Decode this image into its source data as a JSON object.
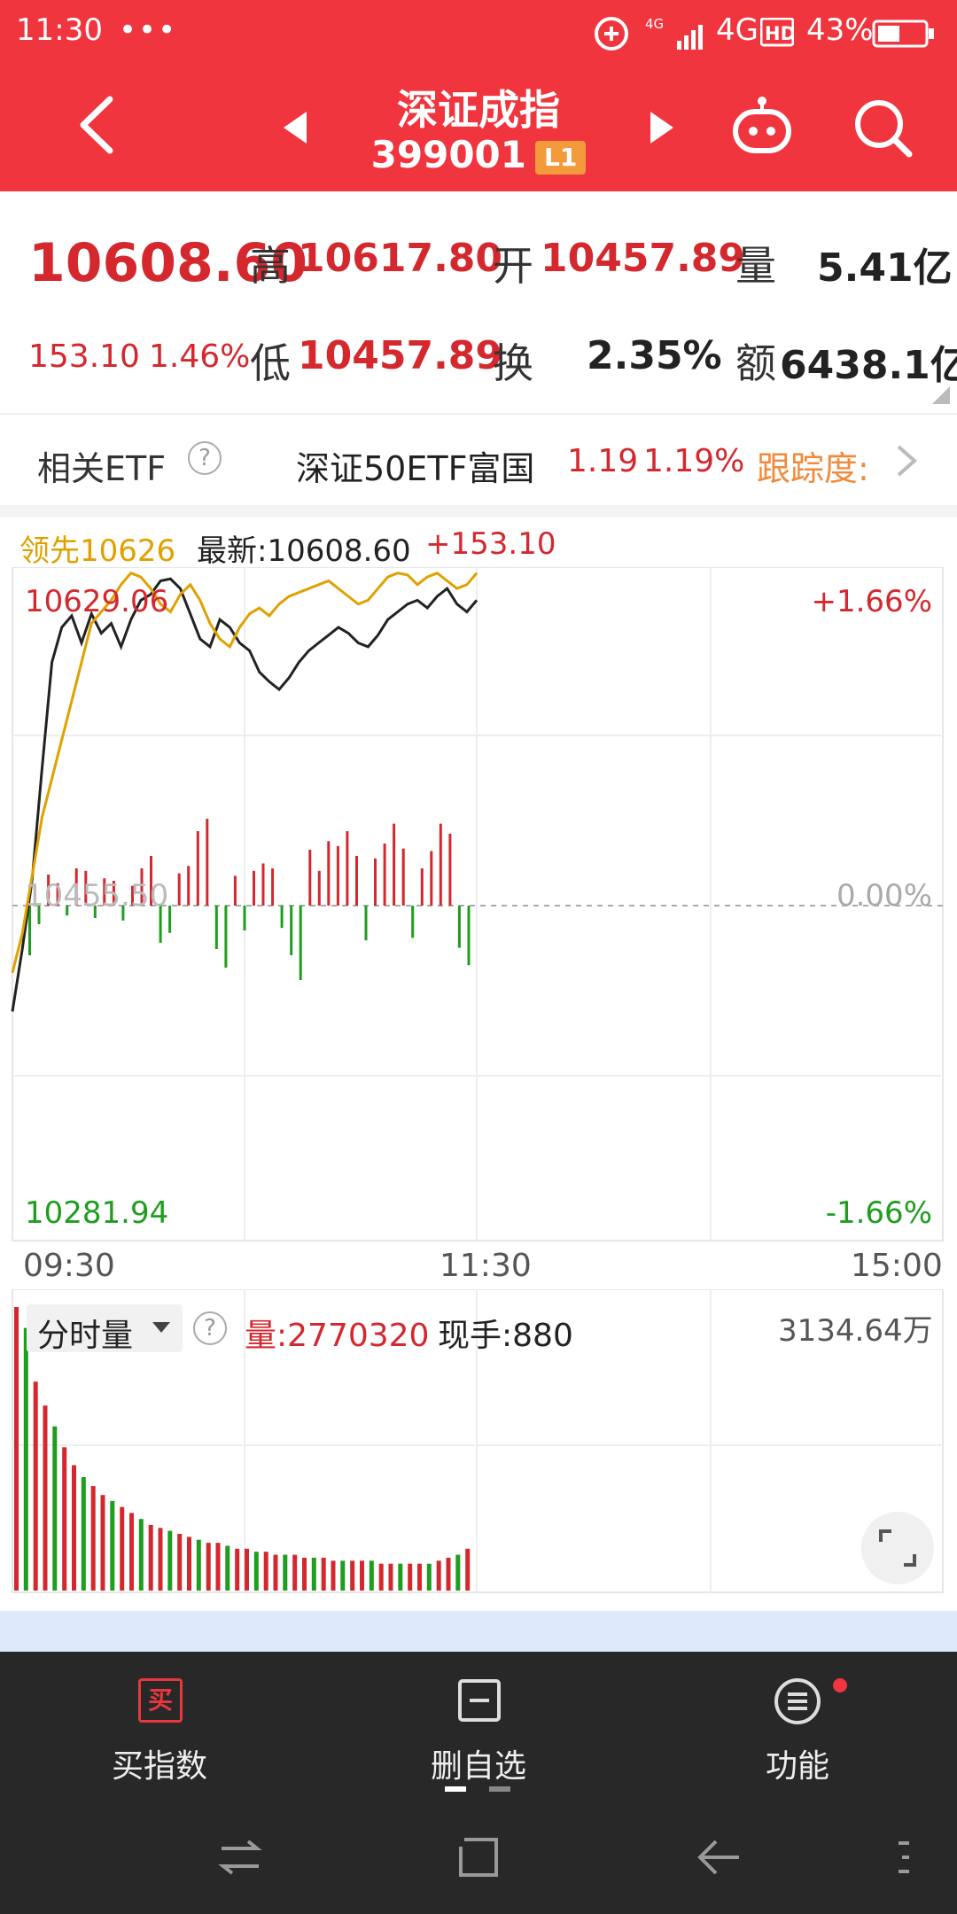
{
  "status": {
    "time": "11:30",
    "dots": "•••",
    "network": "4G",
    "battery": "43%"
  },
  "header": {
    "title": "深证成指",
    "code": "399001",
    "badge": "L1"
  },
  "quote": {
    "price": "10608.60",
    "change": "153.10",
    "change_pct": "1.46%",
    "high_label": "高",
    "high": "10617.80",
    "low_label": "低",
    "low": "10457.89",
    "open_label": "开",
    "open": "10457.89",
    "turnover_label": "换",
    "turnover": "2.35%",
    "volume_label": "量",
    "volume": "5.41亿",
    "amount_label": "额",
    "amount": "6438.1亿"
  },
  "etf": {
    "label": "相关ETF",
    "help": "?",
    "name": "深证50ETF富国",
    "price": "1.19",
    "pct": "1.19%",
    "tracking": "跟踪度:"
  },
  "chart_legend": {
    "lead": "领先10626",
    "latest": "最新:10608.60",
    "delta": "+153.10"
  },
  "chart_labels": {
    "top_left": "10629.06",
    "mid_left": "10455.50",
    "bottom_left": "10281.94",
    "top_right": "+1.66%",
    "mid_right": "0.00%",
    "bottom_right": "-1.66%"
  },
  "time_axis": {
    "start": "09:30",
    "mid": "11:30",
    "end": "15:00"
  },
  "volume_panel": {
    "selector": "分时量",
    "help": "?",
    "volume": "量:2770320",
    "hand": "现手:880",
    "max": "3134.64万"
  },
  "bottom_nav": {
    "buy": "买指数",
    "buy_icon_text": "买",
    "delete": "删自选",
    "func": "功能"
  },
  "colors": {
    "red": "#f0353e",
    "up": "#d4282e",
    "down": "#1f9d1f",
    "lead": "#e0a100"
  },
  "chart_data": {
    "type": "line",
    "ylim": [
      10281.94,
      10629.06
    ],
    "x_range": [
      "09:30",
      "15:00"
    ],
    "series": [
      {
        "name": "最新",
        "values": [
          10400,
          10432,
          10468,
          10525,
          10580,
          10598,
          10604,
          10590,
          10605,
          10595,
          10600,
          10588,
          10602,
          10612,
          10615,
          10622,
          10623,
          10618,
          10605,
          10592,
          10588,
          10602,
          10598,
          10590,
          10586,
          10575,
          10570,
          10566,
          10572,
          10580,
          10586,
          10590,
          10594,
          10598,
          10595,
          10590,
          10588,
          10594,
          10602,
          10606,
          10610,
          10612,
          10608,
          10614,
          10618,
          10610,
          10606,
          10612
        ]
      },
      {
        "name": "领先",
        "values": [
          10420,
          10440,
          10470,
          10500,
          10520,
          10540,
          10560,
          10580,
          10600,
          10606,
          10612,
          10620,
          10626,
          10624,
          10618,
          10610,
          10606,
          10615,
          10620,
          10612,
          10600,
          10592,
          10588,
          10598,
          10605,
          10608,
          10604,
          10610,
          10614,
          10616,
          10618,
          10620,
          10622,
          10618,
          10614,
          10610,
          10612,
          10618,
          10624,
          10626,
          10625,
          10620,
          10624,
          10626,
          10622,
          10618,
          10620,
          10626
        ]
      }
    ],
    "diff_bars": [
      -40,
      -15,
      25,
      18,
      -8,
      30,
      28,
      -10,
      22,
      20,
      -12,
      16,
      30,
      40,
      -30,
      -22,
      26,
      32,
      60,
      70,
      -35,
      -50,
      24,
      -20,
      28,
      34,
      30,
      -18,
      -40,
      -60,
      45,
      28,
      52,
      48,
      60,
      40,
      -28,
      38,
      50,
      66,
      46,
      -26,
      30,
      44,
      66,
      58,
      -34,
      -48
    ],
    "volume_bars": [
      95,
      88,
      70,
      62,
      55,
      48,
      42,
      38,
      35,
      32,
      30,
      28,
      26,
      24,
      22,
      21,
      20,
      19,
      18,
      17,
      16,
      16,
      15,
      14,
      14,
      13,
      13,
      12,
      12,
      12,
      11,
      11,
      11,
      10,
      10,
      10,
      10,
      10,
      9,
      9,
      9,
      9,
      9,
      9,
      10,
      11,
      12,
      14
    ]
  }
}
